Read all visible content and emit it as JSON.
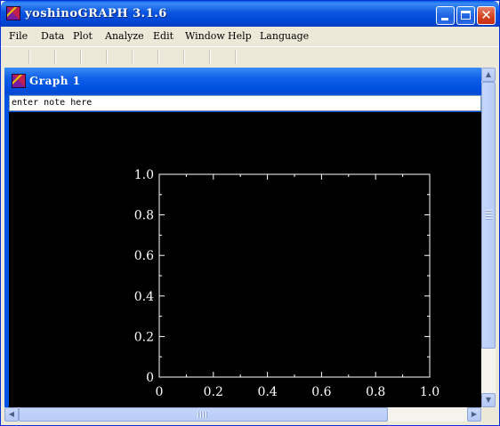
{
  "window": {
    "title": "yoshinoGRAPH 3.1.6",
    "icon": "grape-app-icon"
  },
  "menubar": {
    "items": [
      "File",
      "Data",
      "Plot",
      "Analyze",
      "Edit",
      "Window",
      "Help",
      "Language"
    ]
  },
  "toolbar": {
    "separator_count": 9
  },
  "graph_window": {
    "title": "Graph 1",
    "note_text": "enter note here"
  },
  "chart_data": {
    "type": "scatter",
    "series": [],
    "xlim": [
      0,
      1.0
    ],
    "ylim": [
      0,
      1.0
    ],
    "x_ticks": [
      "0",
      "0.2",
      "0.4",
      "0.6",
      "0.8",
      "1.0"
    ],
    "y_ticks": [
      "0",
      "0.2",
      "0.4",
      "0.6",
      "0.8",
      "1.0"
    ],
    "background": "#000000",
    "axis_color": "#FFFFFF",
    "grid": false
  },
  "colors": {
    "title_bar": "#0054E3",
    "close_button": "#D4401E",
    "window_face": "#ECE9D8"
  }
}
